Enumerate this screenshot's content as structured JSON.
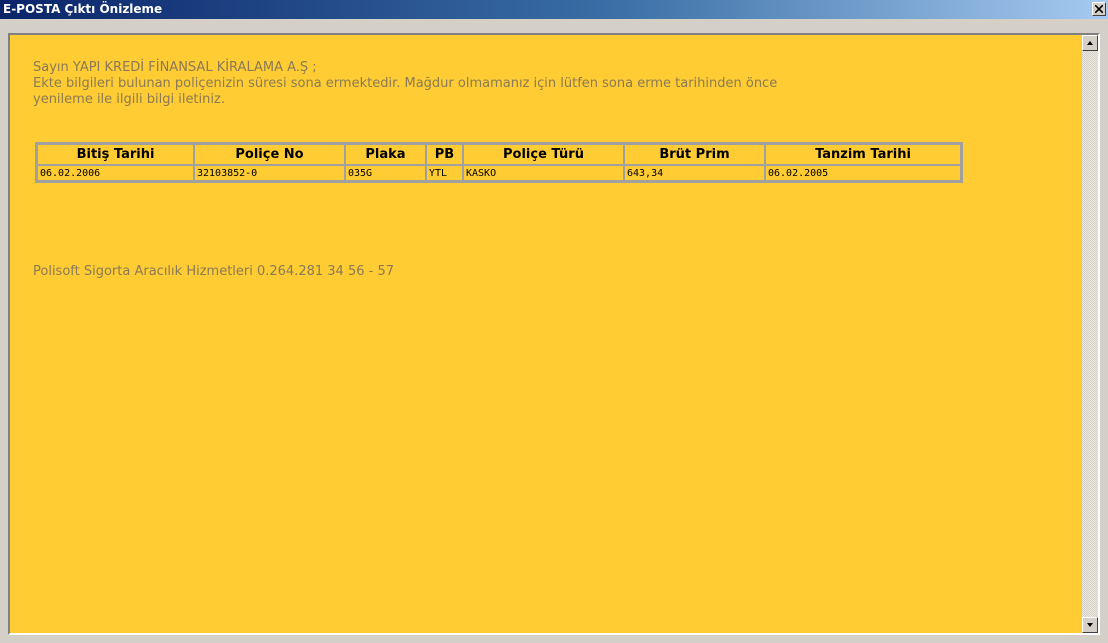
{
  "window": {
    "title": "E-POSTA Çıktı Önizleme"
  },
  "message": {
    "greeting": "Sayın YAPI KREDİ FİNANSAL KİRALAMA A.Ş ;",
    "line1": "Ekte bilgileri bulunan poliçenizin süresi sona ermektedir. Mağdur olmamanız için lütfen sona erme tarihinden önce",
    "line2": "yenileme ile ilgili bilgi iletiniz."
  },
  "table": {
    "headers": [
      "Bitiş Tarihi",
      "Poliçe No",
      "Plaka",
      "PB",
      "Poliçe Türü",
      "Brüt Prim",
      "Tanzim Tarihi"
    ],
    "rows": [
      [
        "06.02.2006",
        "32103852-0",
        "035G",
        "YTL",
        "KASKO",
        "643,34",
        "06.02.2005"
      ]
    ]
  },
  "footer": {
    "text": "Polisoft Sigorta Aracılık Hizmetleri 0.264.281 34 56 - 57"
  },
  "colors": {
    "background": "#ffcc33",
    "text": "#8a7a55",
    "title_bar": "#0a246a"
  },
  "icons": {
    "close": "close-icon",
    "scroll_up": "arrow-up-icon",
    "scroll_down": "arrow-down-icon"
  }
}
